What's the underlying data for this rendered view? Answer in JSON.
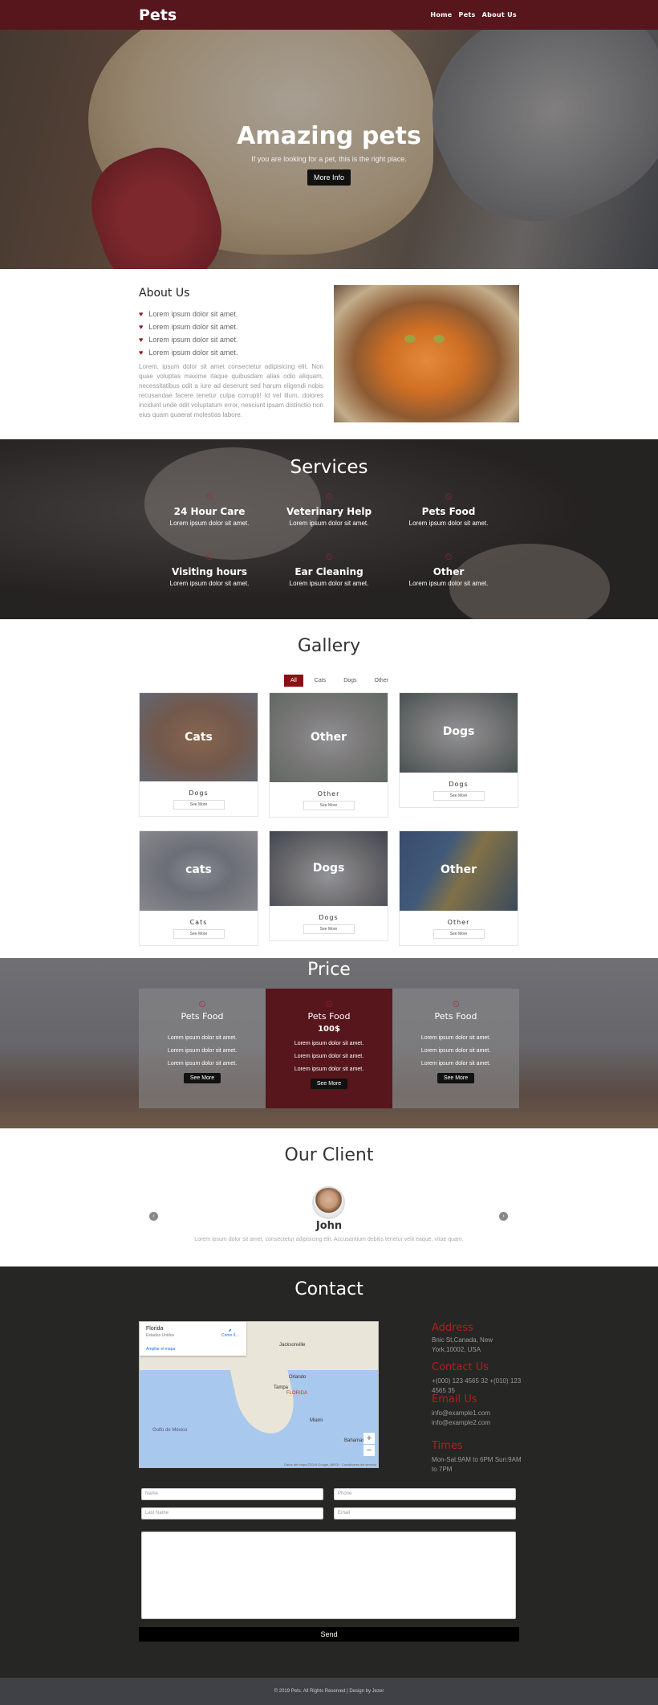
{
  "nav": {
    "brand": "Pets",
    "links": [
      "Home",
      "Pets",
      "About Us"
    ]
  },
  "hero": {
    "title": "Amazing pets",
    "subtitle": "If you are looking for a pet, this is the right place.",
    "button": "More Info"
  },
  "about": {
    "title": "About Us",
    "items": [
      "Lorem ipsum dolor sit amet.",
      "Lorem ipsum dolor sit amet.",
      "Lorem ipsum dolor sit amet.",
      "Lorem ipsum dolor sit amet."
    ],
    "paragraph": "Lorem, ipsum dolor sit amet consectetur adipisicing elit. Non quae voluptas maxime itaque quibusdam alias odio aliquam, necessitatibus odit a iure ad deserunt sed harum eligendi nobis recusandae facere tenetur culpa corrupti! Id vel illum, dolores incidunt unde odit voluptatum error, nesciunt ipsam distinctio non eius quam quaerat molestias labore."
  },
  "services": {
    "title": "Services",
    "items": [
      {
        "name": "24 Hour Care",
        "desc": "Lorem ipsum dolor sit amet."
      },
      {
        "name": "Veterinary Help",
        "desc": "Lorem ipsum dolor sit amet."
      },
      {
        "name": "Pets Food",
        "desc": "Lorem ipsum dolor sit amet."
      },
      {
        "name": "Visiting hours",
        "desc": "Lorem ipsum dolor sit amet."
      },
      {
        "name": "Ear Cleaning",
        "desc": "Lorem ipsum dolor sit amet."
      },
      {
        "name": "Other",
        "desc": "Lorem ipsum dolor sit amet."
      }
    ]
  },
  "gallery": {
    "title": "Gallery",
    "filters": [
      "All",
      "Cats",
      "Dogs",
      "Other"
    ],
    "see_more": "See More",
    "cards": [
      {
        "overlay": "Cats",
        "name": "Dogs"
      },
      {
        "overlay": "Other",
        "name": "Other"
      },
      {
        "overlay": "Dogs",
        "name": "Dogs"
      },
      {
        "overlay": "cats",
        "name": "Cats"
      },
      {
        "overlay": "Dogs",
        "name": "Dogs"
      },
      {
        "overlay": "Other",
        "name": "Other"
      }
    ]
  },
  "price": {
    "title": "Price",
    "plans": [
      {
        "name": "Pets Food",
        "price": "",
        "lines": [
          "Lorem ipsum dolor sit amet.",
          "Lorem ipsum dolor sit amet.",
          "Lorem ipsum dolor sit amet."
        ],
        "button": "See More"
      },
      {
        "name": "Pets Food",
        "price": "100$",
        "lines": [
          "Lorem ipsum dolor sit amet.",
          "Lorem ipsum dolor sit amet.",
          "Lorem ipsum dolor sit amet."
        ],
        "button": "See More"
      },
      {
        "name": "Pets Food",
        "price": "",
        "lines": [
          "Lorem ipsum dolor sit amet.",
          "Lorem ipsum dolor sit amet.",
          "Lorem ipsum dolor sit amet."
        ],
        "button": "See More"
      }
    ]
  },
  "client": {
    "title": "Our Client",
    "name": "John",
    "quote": "Lorem ipsum dolor sit amet, consectetur adipisicing elit. Accusantium debitis tenetur velit eaque, vitae quam."
  },
  "contact": {
    "title": "Contact",
    "map": {
      "place": "Florida",
      "country": "Estados Unidos",
      "enlarge": "Ampliar el mapa",
      "directions": "Cómo ll...",
      "labels": [
        "Jacksonville",
        "Orlando",
        "Tampa",
        "FLORIDA",
        "Miami",
        "Golfo de México",
        "Bahamas"
      ],
      "credit": "Datos del mapa ©2019 Google, INEGI · Condiciones del servicio"
    },
    "address_head": "Address",
    "address": "Bnic St,Canada, New York,10002, USA",
    "phone_head": "Contact Us",
    "phone": "+(000) 123 4565 32 +(010) 123 4565 35",
    "email_head": "Email Us",
    "emails": [
      "info@example1.com",
      "info@example2.com"
    ],
    "times_head": "Times",
    "times": "Mon-Sat:9AM to 6PM Sun:9AM to 7PM",
    "form": {
      "name_ph": "Name",
      "phone_ph": "Phone",
      "lastname_ph": "Last Name",
      "email_ph": "Email",
      "send": "Send"
    }
  },
  "footer": "© 2019 Pets. All Rights Reserved | Design by Jezer"
}
